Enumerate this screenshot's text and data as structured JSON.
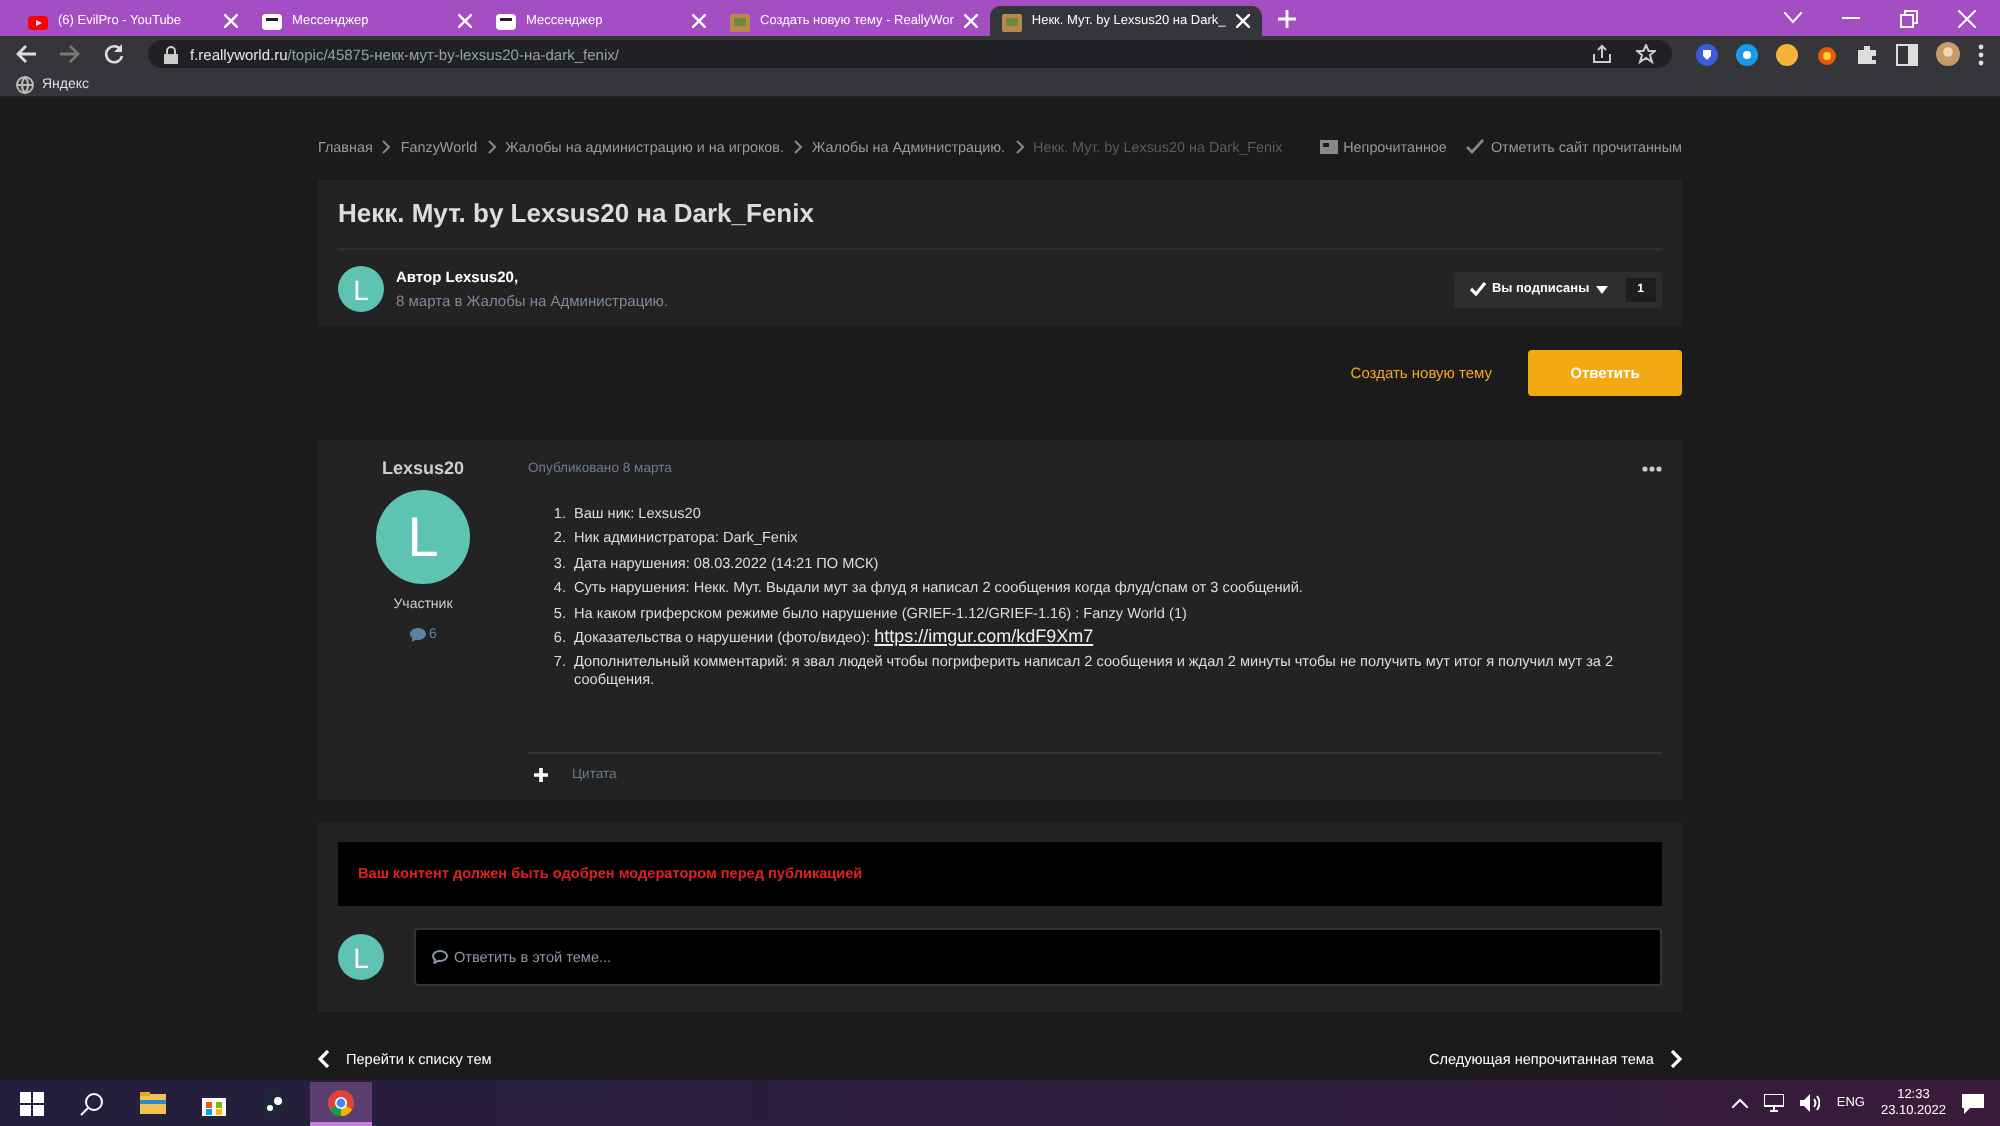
{
  "browser": {
    "tabs": [
      {
        "title": "(6) EvilPro - YouTube",
        "kind": "video",
        "selected": false
      },
      {
        "title": "Мессенджер",
        "kind": "chat",
        "selected": false
      },
      {
        "title": "Мессенджер",
        "kind": "chat",
        "selected": false
      },
      {
        "title": "Создать новую тему - ReallyWor",
        "kind": "site",
        "selected": false
      },
      {
        "title": "Некк. Мут. by Lexsus20 на Dark_",
        "kind": "site",
        "selected": true
      }
    ],
    "address": {
      "domain": "f.reallyworld.ru",
      "path": "/topic/45875-некк-мут-by-lexsus20-на-dark_fenix/"
    },
    "bookmarks": [
      "Яндекс"
    ]
  },
  "breadcrumbs": [
    {
      "label": "Главная",
      "current": false
    },
    {
      "label": "FanzyWorld",
      "current": false
    },
    {
      "label": "Жалобы на администрацию и на игроков.",
      "current": false
    },
    {
      "label": "Жалобы на Администрацию.",
      "current": false
    },
    {
      "label": "Некк. Мут. by Lexsus20 на Dark_Fenix",
      "current": true
    }
  ],
  "site_actions": [
    "Непрочитанное",
    "Отметить сайт прочитанным"
  ],
  "topic": {
    "title": "Некк. Мут. by Lexsus20 на Dark_Fenix",
    "avatar_letter": "L",
    "author": "Автор Lexsus20,",
    "meta": "8 марта в Жалобы на Администрацию.",
    "follow": {
      "label": "Вы подписаны",
      "count": "1"
    }
  },
  "topic_actions": {
    "secondary": "Создать новую тему",
    "primary": "Ответить"
  },
  "post": {
    "author": "Lexsus20",
    "avatar_letter": "L",
    "role": "Участник",
    "post_count": "6",
    "date": "Опубликовано 8 марта",
    "items": [
      {
        "number": "1.",
        "text": "Ваш ник: Lexsus20"
      },
      {
        "number": "2.",
        "text": "Ник администратора:  Dark_Fenix"
      },
      {
        "number": "3.",
        "text": "Дата нарушения: 08.03.2022 (14:21 ПО МСК)"
      },
      {
        "number": "4.",
        "text": "Суть нарушения: Некк. Мут. Выдали мут за флуд я написал 2 сообщения когда флуд/спам от 3 сообщений."
      },
      {
        "number": "5.",
        "text": "На каком гриферском режиме было нарушение (GRIEF-1.12/GRIEF-1.16) : Fanzy World (1)"
      },
      {
        "number": "6.",
        "text": "Доказательства о нарушении (фото/видео):",
        "link": "https://imgur.com/kdF9Xm7"
      },
      {
        "number": "7.",
        "text": "Дополнительный комментарий: я звал людей чтобы погриферить написал 2 сообщения и ждал 2 минуты чтобы не получить мут итог я получил мут за 2 сообщения."
      }
    ],
    "quote": "Цитата"
  },
  "reply": {
    "notice": "Ваш контент должен быть одобрен модератором перед публикацией",
    "avatar_letter": "L",
    "placeholder": "Ответить в этой теме..."
  },
  "pager": {
    "previous": "Перейти к списку тем",
    "next": "Следующая непрочитанная тема"
  },
  "taskbar": {
    "language": "ENG",
    "time": "12:33",
    "date": "23.10.2022"
  }
}
